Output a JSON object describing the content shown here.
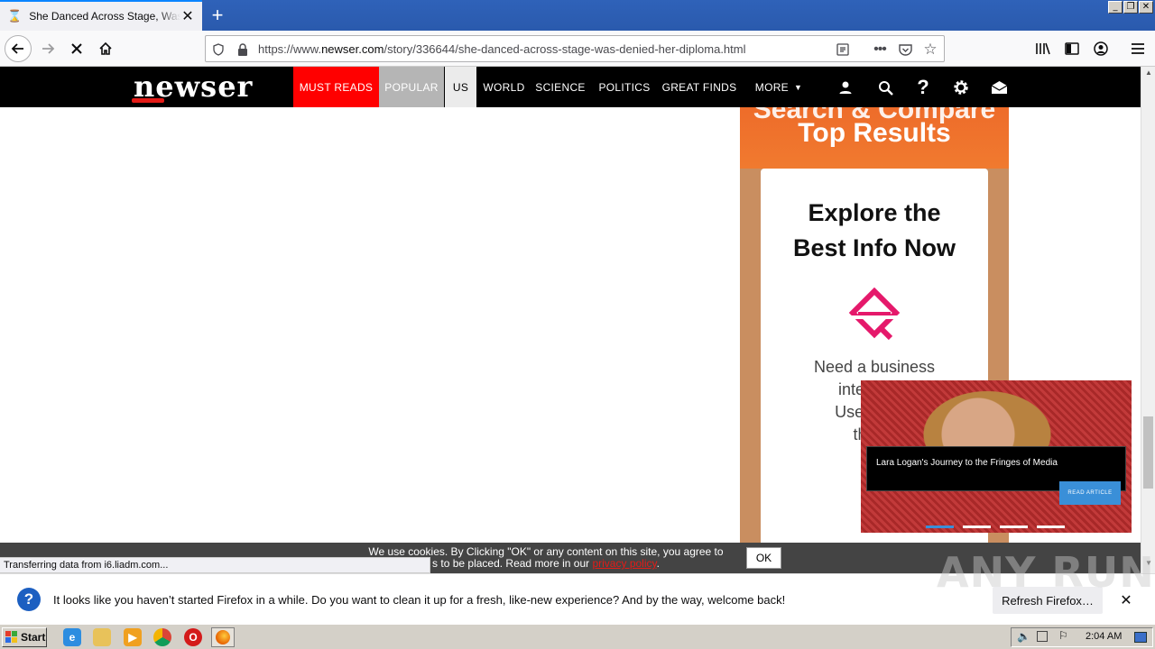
{
  "browser": {
    "tab_title": "She Danced Across Stage, Was Denied Her Diploma",
    "url_prefix": "https://www.",
    "url_domain": "newser.com",
    "url_path": "/story/336644/she-danced-across-stage-was-denied-her-diploma.html",
    "window_controls": [
      "_",
      "❐",
      "✕"
    ]
  },
  "site": {
    "logo": "newser",
    "nav": [
      "MUST READS",
      "POPULAR",
      "US",
      "WORLD",
      "SCIENCE",
      "POLITICS",
      "GREAT FINDS",
      "MORE"
    ],
    "colors": {
      "must_reads_bg": "#ff0000",
      "popular_bg": "#b5b5b5",
      "us_bg": "#ebebeb"
    }
  },
  "ad": {
    "banner_line1": "Search & Compare",
    "banner_line2": "Top Results",
    "title_line1": "Explore the",
    "title_line2": "Best Info Now",
    "body_lines": [
      "Need a business",
      "intelligenc",
      "Use The LI",
      "the W"
    ]
  },
  "video_widget": {
    "caption": "Lara Logan's Journey to the Fringes of Media",
    "read_button": "READ ARTICLE"
  },
  "cookie": {
    "text_line1": "We use cookies. By Clicking \"OK\" or any content on this site, you agree to",
    "text_line2_prefix": "s to be placed. Read more in our ",
    "link": "privacy policy",
    "text_line2_suffix": ".",
    "ok_label": "OK"
  },
  "status_text": "Transferring data from i6.liadm.com...",
  "notification": {
    "message": "It looks like you haven’t started Firefox in a while. Do you want to clean it up for a fresh, like-new experience? And by the way, welcome back!",
    "button": "Refresh Firefox…"
  },
  "watermark": "ANY RUN",
  "taskbar": {
    "start_label": "Start",
    "clock": "2:04 AM"
  }
}
